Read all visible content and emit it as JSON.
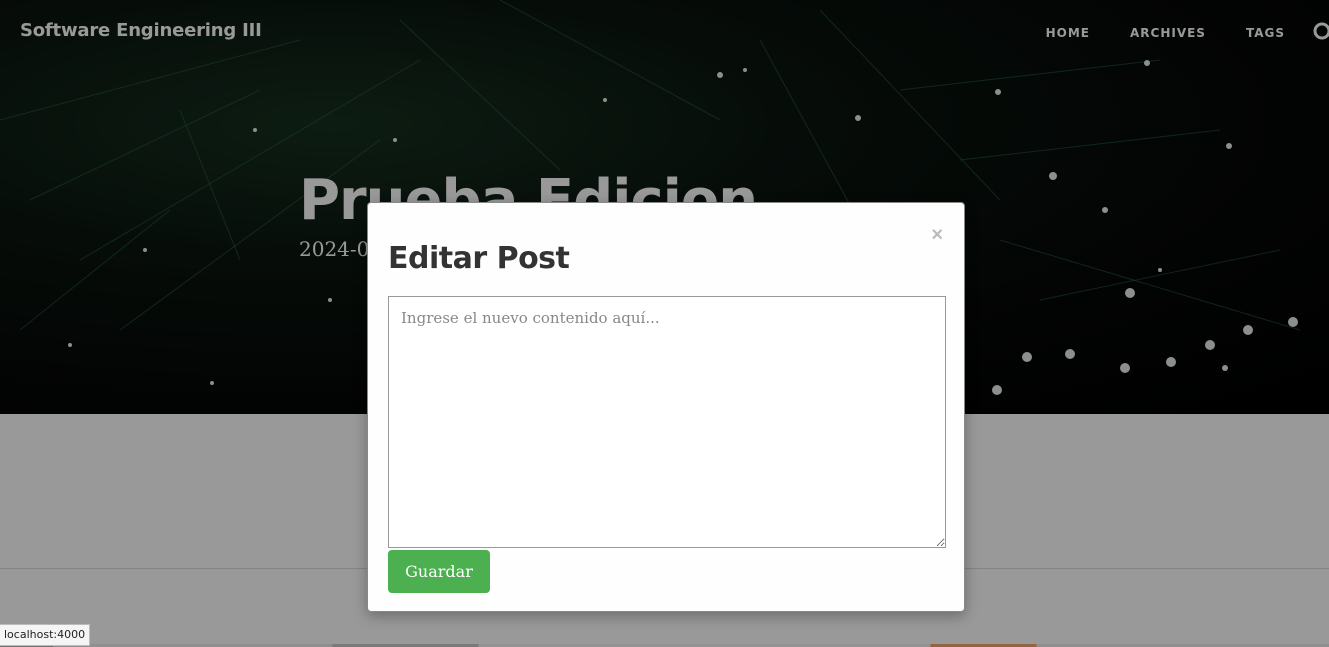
{
  "navbar": {
    "brand": "Software Engineering III",
    "links": [
      {
        "label": "HOME"
      },
      {
        "label": "ARCHIVES"
      },
      {
        "label": "TAGS"
      }
    ]
  },
  "post": {
    "title": "Prueba Edicion",
    "date": "2024-0"
  },
  "modal": {
    "close_label": "×",
    "title": "Editar Post",
    "textarea_placeholder": "Ingrese el nuevo contenido aquí...",
    "save_label": "Guardar"
  },
  "status_bar": {
    "url": "localhost:4000"
  },
  "colors": {
    "save_button": "#4caf50",
    "overlay": "rgba(0,0,0,0.4)"
  },
  "icons": {
    "github": "github-icon",
    "close": "close-icon"
  }
}
